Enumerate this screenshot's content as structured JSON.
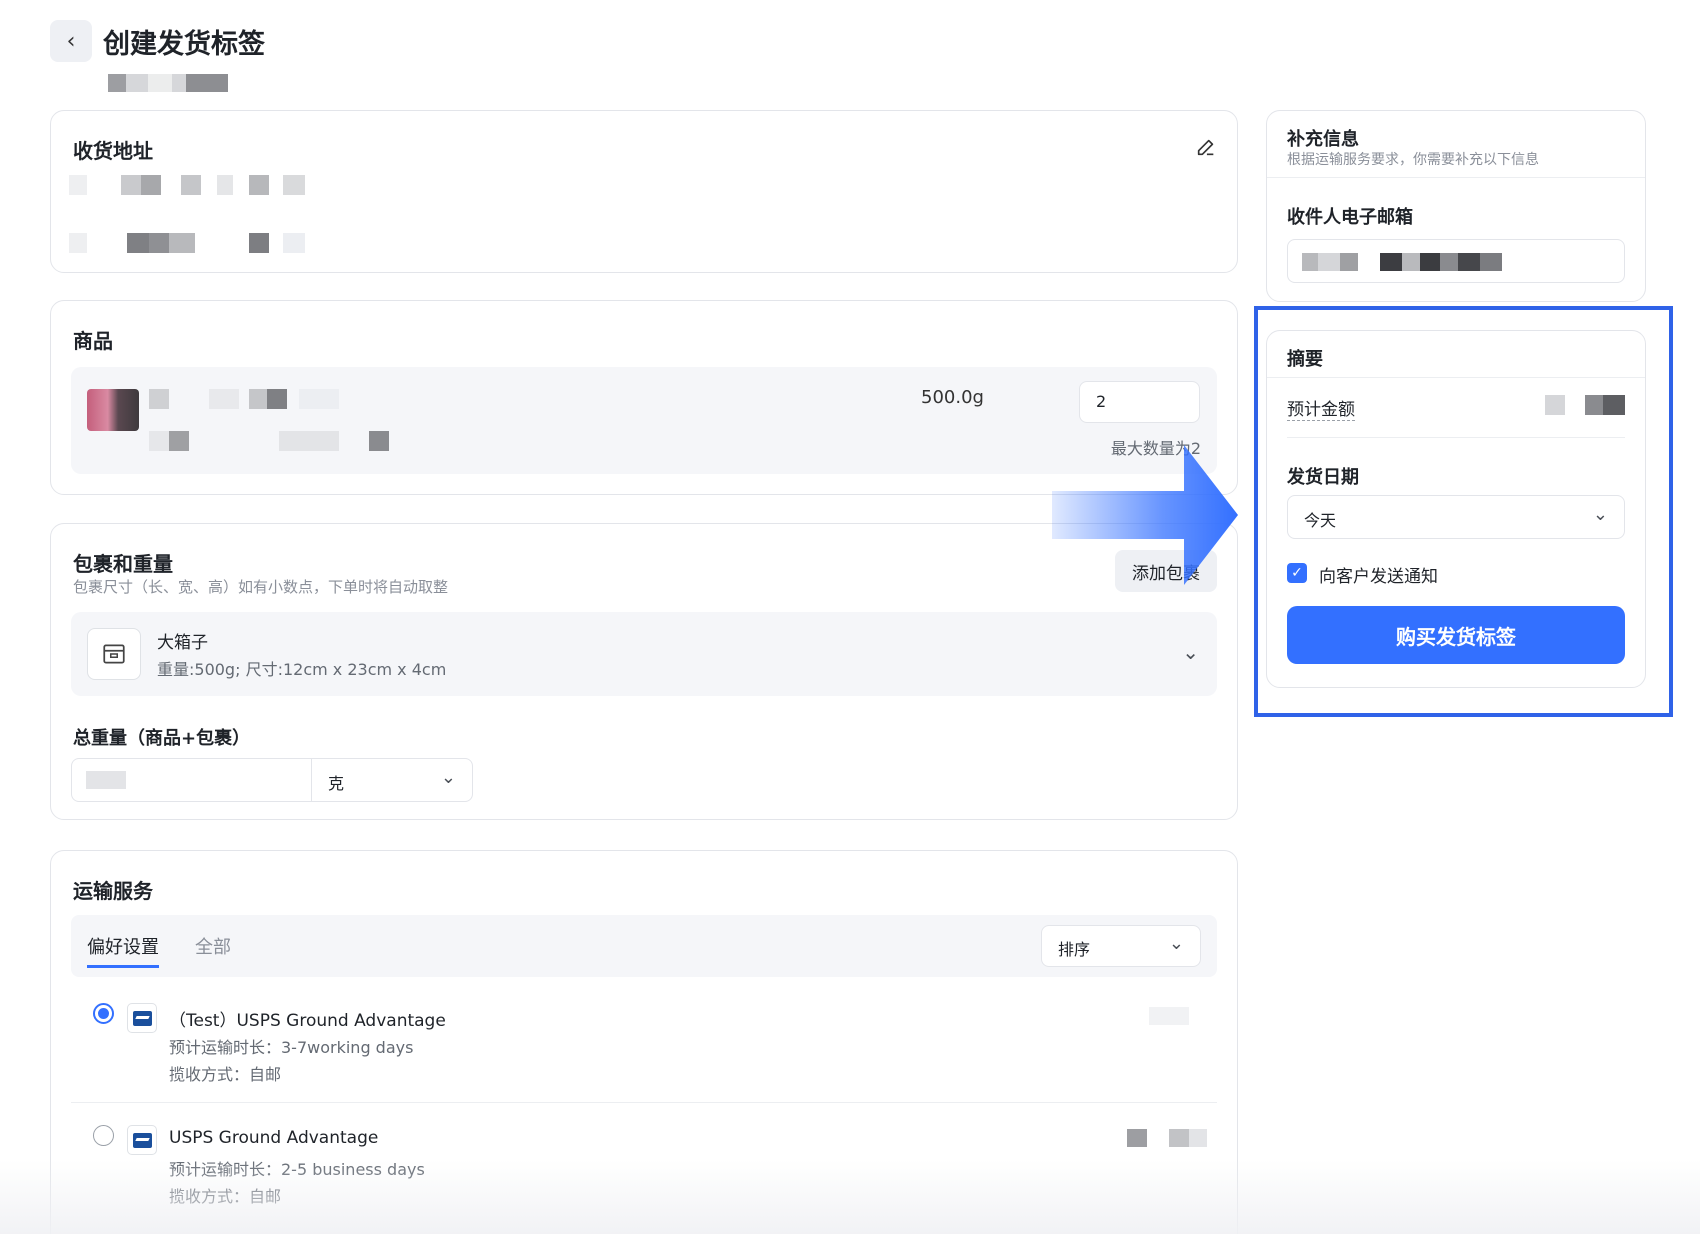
{
  "header": {
    "back_icon": "chevron-left-icon",
    "title": "创建发货标签"
  },
  "address": {
    "title": "收货地址",
    "edit_icon": "pencil-icon"
  },
  "products": {
    "title": "商品",
    "item": {
      "weight": "500.0g",
      "quantity": "2",
      "max_note": "最大数量为2"
    }
  },
  "package": {
    "title": "包裹和重量",
    "subtitle": "包裹尺寸（长、宽、高）如有小数点，下单时将自动取整",
    "add_button": "添加包裹",
    "selected": {
      "icon": "box-icon",
      "name": "大箱子",
      "detail": "重量:500g; 尺寸:12cm x 23cm x 4cm"
    },
    "total_weight_label": "总重量（商品+包裹）",
    "unit": "克"
  },
  "shipping": {
    "title": "运输服务",
    "tabs": [
      "偏好设置",
      "全部"
    ],
    "active_tab": 0,
    "sort_label": "排序",
    "services": [
      {
        "name": "（Test）USPS Ground Advantage",
        "duration": "预计运输时长：3-7working days",
        "pickup": "揽收方式：自邮",
        "selected": true
      },
      {
        "name": "USPS Ground Advantage",
        "duration": "预计运输时长：2-5 business days",
        "pickup": "揽收方式：自邮",
        "selected": false
      }
    ]
  },
  "extra_info": {
    "title": "补充信息",
    "subtitle": "根据运输服务要求，你需要补充以下信息",
    "email_label": "收件人电子邮箱"
  },
  "summary": {
    "title": "摘要",
    "estimated_label": "预计金额",
    "ship_date_label": "发货日期",
    "ship_date_value": "今天",
    "notify_label": "向客户发送通知",
    "notify_checked": true,
    "buy_button": "购买发货标签"
  },
  "colors": {
    "primary": "#3370ff",
    "highlight": "#2f62e8"
  }
}
